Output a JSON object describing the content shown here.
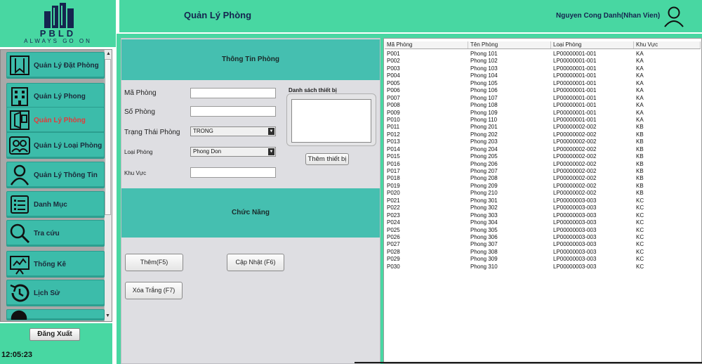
{
  "brand": {
    "name": "PBLD",
    "tagline": "ALWAYS GO ON"
  },
  "header": {
    "title": "Quản Lý Phòng",
    "user": "Nguyen Cong Danh(Nhan Vien)",
    "user_icon": "user-icon"
  },
  "sidebar": {
    "items": [
      {
        "label": "Quản Lý Đặt Phòng",
        "icon": "bookmark-icon",
        "active": false
      },
      {
        "label": "Quản Lý Phong",
        "icon": "building-icon",
        "active": false
      },
      {
        "label": "Quản Lý Phòng",
        "icon": "room-icon",
        "active": true
      },
      {
        "label": "Quản Lý Loại Phòng",
        "icon": "people-icon",
        "active": false
      },
      {
        "label": "Quản Lý Thông Tin",
        "icon": "person-icon",
        "active": false
      },
      {
        "label": "Danh Mục",
        "icon": "list-icon",
        "active": false
      },
      {
        "label": "Tra cứu",
        "icon": "search-icon",
        "active": false
      },
      {
        "label": "Thống Kê",
        "icon": "chart-board-icon",
        "active": false
      },
      {
        "label": "Lịch Sử",
        "icon": "history-icon",
        "active": false
      }
    ],
    "logout": "Đăng Xuất",
    "clock": "12:05:23"
  },
  "form": {
    "info_title": "Thông Tin Phòng",
    "ma_phong_label": "Mã Phòng",
    "so_phong_label": "Số Phòng",
    "trang_thai_label": "Trạng Thái Phòng",
    "trang_thai_value": "TRONG",
    "loai_phong_label": "Loại Phòng",
    "loai_phong_value": "Phong Don",
    "khu_vuc_label": "Khu Vực",
    "equipment_label": "Danh sách thiết bị",
    "add_equipment": "Thêm thiết bị",
    "function_title": "Chức Năng",
    "btn_add": "Thêm(F5)",
    "btn_update": "Cập Nhật (F6)",
    "btn_clear": "Xóa Trắng (F7)"
  },
  "table": {
    "columns": [
      "Mã Phòng",
      "Tên Phòng",
      "Loại Phòng",
      "Khu Vực"
    ],
    "rows": [
      [
        "P001",
        "Phong 101",
        "LP00000001-001",
        "KA"
      ],
      [
        "P002",
        "Phong 102",
        "LP00000001-001",
        "KA"
      ],
      [
        "P003",
        "Phong 103",
        "LP00000001-001",
        "KA"
      ],
      [
        "P004",
        "Phong 104",
        "LP00000001-001",
        "KA"
      ],
      [
        "P005",
        "Phong 105",
        "LP00000001-001",
        "KA"
      ],
      [
        "P006",
        "Phong 106",
        "LP00000001-001",
        "KA"
      ],
      [
        "P007",
        "Phong 107",
        "LP00000001-001",
        "KA"
      ],
      [
        "P008",
        "Phong 108",
        "LP00000001-001",
        "KA"
      ],
      [
        "P009",
        "Phong 109",
        "LP00000001-001",
        "KA"
      ],
      [
        "P010",
        "Phong 110",
        "LP00000001-001",
        "KA"
      ],
      [
        "P011",
        "Phong 201",
        "LP00000002-002",
        "KB"
      ],
      [
        "P012",
        "Phong 202",
        "LP00000002-002",
        "KB"
      ],
      [
        "P013",
        "Phong 203",
        "LP00000002-002",
        "KB"
      ],
      [
        "P014",
        "Phong 204",
        "LP00000002-002",
        "KB"
      ],
      [
        "P015",
        "Phong 205",
        "LP00000002-002",
        "KB"
      ],
      [
        "P016",
        "Phong 206",
        "LP00000002-002",
        "KB"
      ],
      [
        "P017",
        "Phong 207",
        "LP00000002-002",
        "KB"
      ],
      [
        "P018",
        "Phong 208",
        "LP00000002-002",
        "KB"
      ],
      [
        "P019",
        "Phong 209",
        "LP00000002-002",
        "KB"
      ],
      [
        "P020",
        "Phong 210",
        "LP00000002-002",
        "KB"
      ],
      [
        "P021",
        "Phong 301",
        "LP00000003-003",
        "KC"
      ],
      [
        "P022",
        "Phong 302",
        "LP00000003-003",
        "KC"
      ],
      [
        "P023",
        "Phong 303",
        "LP00000003-003",
        "KC"
      ],
      [
        "P024",
        "Phong 304",
        "LP00000003-003",
        "KC"
      ],
      [
        "P025",
        "Phong 305",
        "LP00000003-003",
        "KC"
      ],
      [
        "P026",
        "Phong 306",
        "LP00000003-003",
        "KC"
      ],
      [
        "P027",
        "Phong 307",
        "LP00000003-003",
        "KC"
      ],
      [
        "P028",
        "Phong 308",
        "LP00000003-003",
        "KC"
      ],
      [
        "P029",
        "Phong 309",
        "LP00000003-003",
        "KC"
      ],
      [
        "P030",
        "Phong 310",
        "LP00000003-003",
        "KC"
      ]
    ]
  },
  "colors": {
    "accent": "#48d7a2",
    "nav": "#3cbcaa",
    "section": "#45bfb0",
    "active_text": "#e23b3b"
  }
}
